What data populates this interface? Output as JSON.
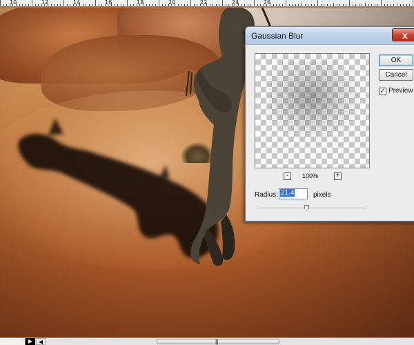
{
  "ruler": {
    "labels": [
      "10",
      "12",
      "14",
      "16",
      "18",
      "20",
      "22",
      "24",
      "26"
    ]
  },
  "dialog": {
    "title": "Gaussian Blur",
    "close_symbol": "x",
    "ok_label": "OK",
    "cancel_label": "Cancel",
    "preview_label": "Preview",
    "preview_checked": true,
    "check_symbol": "✓",
    "zoom_out_symbol": "-",
    "zoom_in_symbol": "+",
    "zoom_level": "100%",
    "radius_label": "Radius:",
    "radius_value": "21.4",
    "radius_unit": "pixels",
    "slider_position": 0.45
  },
  "scrollbar": {
    "right_arrow": "▶",
    "left_arrow": "◀",
    "grip": "|||"
  },
  "colors": {
    "title_gradient": "#bcd2ec",
    "close_button": "#c9472e",
    "selection": "#3a6fd4",
    "sand": "#b86a34"
  }
}
